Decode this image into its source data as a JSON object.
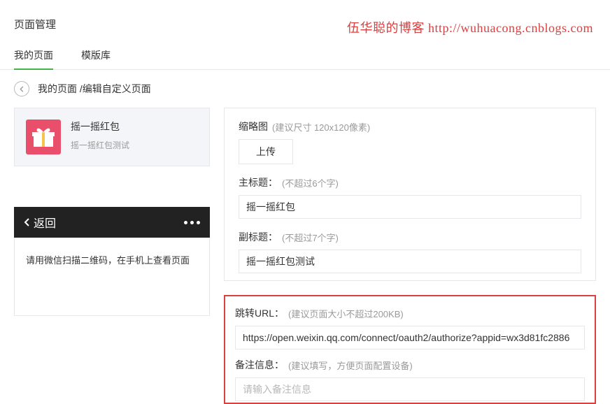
{
  "watermark": "伍华聪的博客 http://wuhuacong.cnblogs.com",
  "page_title": "页面管理",
  "tabs": [
    "我的页面",
    "模版库"
  ],
  "breadcrumb": {
    "link": "我的页面",
    "sep": " /",
    "current": "编辑自定义页面"
  },
  "promo": {
    "title": "摇一摇红包",
    "subtitle": "摇一摇红包测试"
  },
  "form": {
    "thumbnail": {
      "label": "缩略图",
      "hint": "(建议尺寸 120x120像素)",
      "upload": "上传"
    },
    "main_title": {
      "label": "主标题：",
      "hint": "(不超过6个字)",
      "value": "摇一摇红包"
    },
    "sub_title": {
      "label": "副标题：",
      "hint": "(不超过7个字)",
      "value": "摇一摇红包测试"
    },
    "redirect": {
      "label": "跳转URL：",
      "hint": "(建议页面大小不超过200KB)",
      "value": "https://open.weixin.qq.com/connect/oauth2/authorize?appid=wx3d81fc2886"
    },
    "remark": {
      "label": "备注信息：",
      "hint": "(建议填写，方便页面配置设备)",
      "placeholder": "请输入备注信息"
    }
  },
  "blackbar": {
    "back": "返回"
  },
  "qr_hint": "请用微信扫描二维码，在手机上查看页面"
}
